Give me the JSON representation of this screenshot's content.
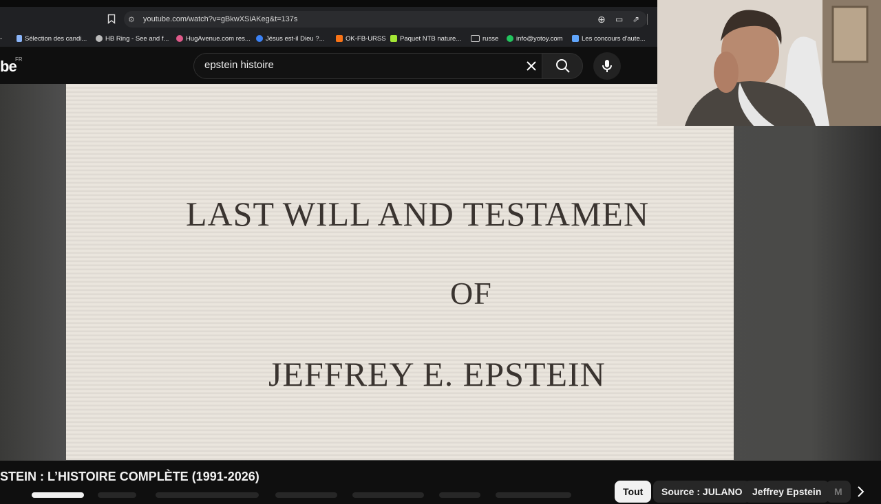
{
  "browser": {
    "url": "youtube.com/watch?v=gBkwXSiAKeg&t=137s",
    "bookmarks": [
      {
        "label": "Sélection des candi...",
        "color": "#8ab4f8"
      },
      {
        "label": "HB Ring - See and f...",
        "color": "#bbbbbb"
      },
      {
        "label": "HugAvenue.com res...",
        "color": "#e05a8a"
      },
      {
        "label": "Jésus est-il Dieu ?...",
        "color": "#3b82f6"
      },
      {
        "label": "OK-FB-URSS",
        "color": "#f97316"
      },
      {
        "label": "Paquet NTB nature...",
        "color": "#a3e635"
      },
      {
        "label": "russe",
        "color": "#cccccc"
      },
      {
        "label": "info@yotoy.com",
        "color": "#22c55e"
      },
      {
        "label": "Les concours d'aute...",
        "color": "#60a5fa"
      }
    ]
  },
  "youtube": {
    "logo_text": "be",
    "logo_region": "FR",
    "search_value": "epstein histoire"
  },
  "video": {
    "frame_lines": [
      "LAST WILL AND TESTAMEN",
      "OF",
      "JEFFREY E. EPSTEIN"
    ],
    "title": "STEIN : L’HISTOIRE COMPLÈTE (1991-2026)"
  },
  "chips": [
    {
      "label": "Tout",
      "active": true
    },
    {
      "label": "Source : JULANO",
      "active": false
    },
    {
      "label": "Jeffrey Epstein",
      "active": false
    },
    {
      "label": "M",
      "active": false
    }
  ]
}
